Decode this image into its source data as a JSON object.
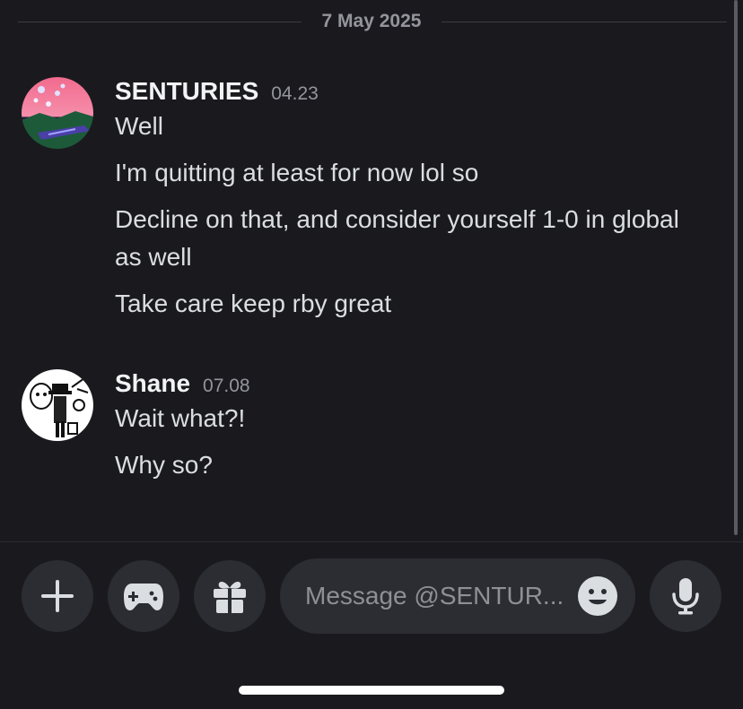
{
  "date_divider": "7 May 2025",
  "messages": [
    {
      "author": "SENTURIES",
      "time": "04.23",
      "lines": [
        "Well",
        "I'm quitting at least for now lol so",
        "Decline on that, and consider yourself 1-0 in global as well",
        "Take care keep rby great"
      ]
    },
    {
      "author": "Shane",
      "time": "07.08",
      "lines": [
        "Wait what?!",
        "Why so?"
      ]
    }
  ],
  "composer": {
    "placeholder": "Message @SENTUR...",
    "buttons": {
      "add": "plus-icon",
      "activities": "gamepad-icon",
      "gift": "gift-icon",
      "voice": "microphone-icon",
      "emoji": "emoji-icon"
    }
  },
  "colors": {
    "background": "#1a1a1e",
    "button": "#2b2d33",
    "text": "#dbdee1",
    "muted": "#94959c"
  }
}
